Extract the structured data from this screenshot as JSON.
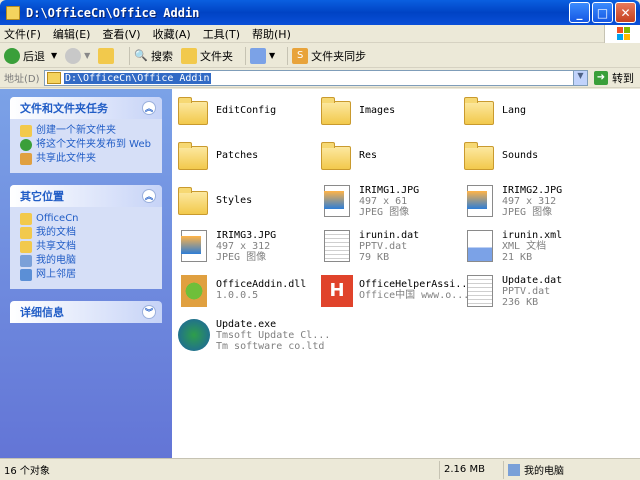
{
  "window": {
    "title": "D:\\OfficeCn\\Office Addin",
    "buttons": {
      "min": "_",
      "max": "□",
      "close": "✕"
    }
  },
  "menubar": [
    "文件(F)",
    "编辑(E)",
    "查看(V)",
    "收藏(A)",
    "工具(T)",
    "帮助(H)"
  ],
  "toolbar": {
    "back": "后退",
    "search": "搜索",
    "folders": "文件夹",
    "sync": "文件夹同步"
  },
  "address": {
    "label": "地址(D)",
    "value": "D:\\OfficeCn\\Office Addin",
    "go": "转到"
  },
  "left": {
    "tasks": {
      "title": "文件和文件夹任务",
      "items": [
        "创建一个新文件夹",
        "将这个文件夹发布到 Web",
        "共享此文件夹"
      ]
    },
    "places": {
      "title": "其它位置",
      "items": [
        "OfficeCn",
        "我的文档",
        "共享文档",
        "我的电脑",
        "网上邻居"
      ]
    },
    "details": {
      "title": "详细信息"
    }
  },
  "files": [
    {
      "name": "EditConfig",
      "kind": "folder"
    },
    {
      "name": "Images",
      "kind": "folder"
    },
    {
      "name": "Lang",
      "kind": "folder"
    },
    {
      "name": "Patches",
      "kind": "folder"
    },
    {
      "name": "Res",
      "kind": "folder"
    },
    {
      "name": "Sounds",
      "kind": "folder"
    },
    {
      "name": "Styles",
      "kind": "folder"
    },
    {
      "name": "IRIMG1.JPG",
      "kind": "image",
      "line2": "497 x 61",
      "line3": "JPEG 图像"
    },
    {
      "name": "IRIMG2.JPG",
      "kind": "image",
      "line2": "497 x 312",
      "line3": "JPEG 图像"
    },
    {
      "name": "IRIMG3.JPG",
      "kind": "image",
      "line2": "497 x 312",
      "line3": "JPEG 图像"
    },
    {
      "name": "irunin.dat",
      "kind": "dat",
      "line2": "PPTV.dat",
      "line3": "79 KB"
    },
    {
      "name": "irunin.xml",
      "kind": "xml",
      "line2": "XML 文档",
      "line3": "21 KB"
    },
    {
      "name": "OfficeAddin.dll",
      "kind": "dll",
      "line2": "1.0.0.5",
      "line3": ""
    },
    {
      "name": "OfficeHelperAssi...",
      "kind": "exe-h",
      "line2": "Office中国 www.o...",
      "line3": ""
    },
    {
      "name": "Update.dat",
      "kind": "dat",
      "line2": "PPTV.dat",
      "line3": "236 KB"
    },
    {
      "name": "Update.exe",
      "kind": "exe-u",
      "line2": "Tmsoft Update Cl...",
      "line3": "Tm software co.ltd"
    }
  ],
  "status": {
    "count": "16 个对象",
    "size": "2.16 MB",
    "location": "我的电脑"
  },
  "colors": {
    "accent": "#316ac5",
    "title_blue": "#0a4fd8",
    "task_text": "#215dc6"
  }
}
